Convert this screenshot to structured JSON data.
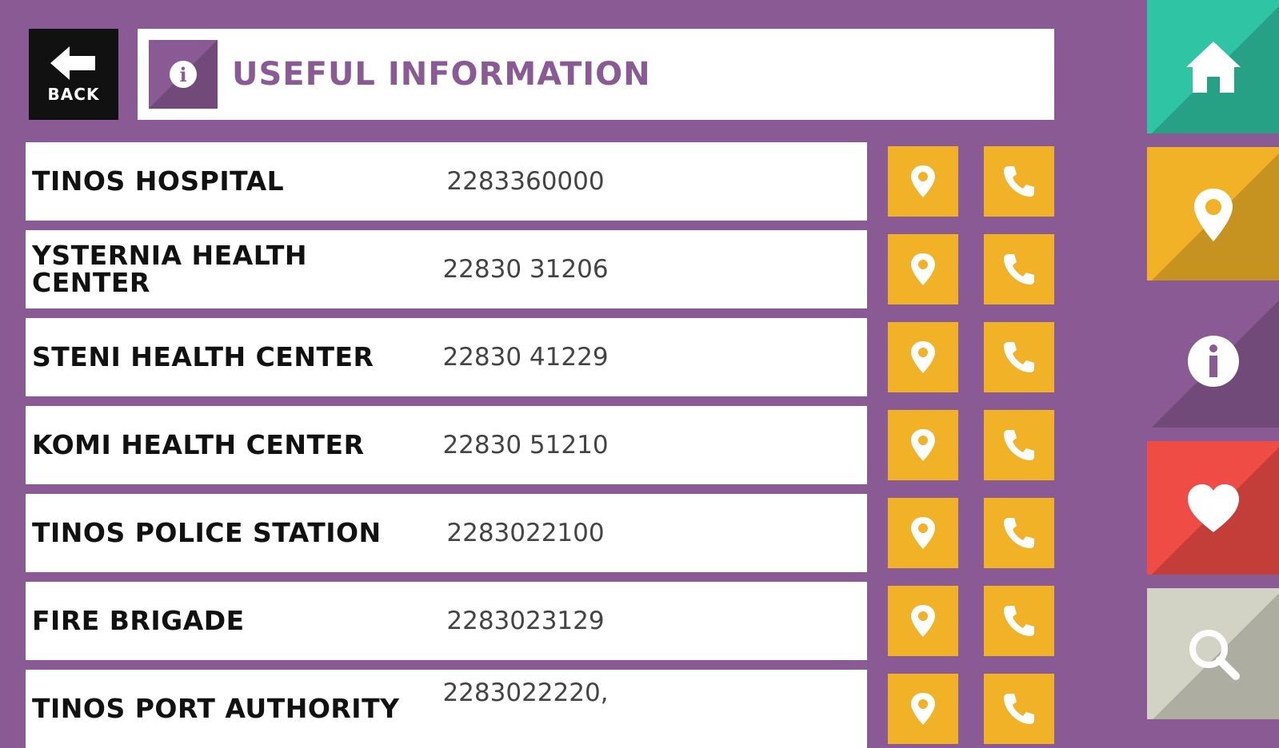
{
  "header": {
    "back_label": "BACK",
    "title": "USEFUL INFORMATION",
    "icon": "info-icon"
  },
  "colors": {
    "background": "#8a5a95",
    "action_button": "#f2b227",
    "home": "#2ec4a4",
    "map": "#f2b227",
    "info": "#8a5a95",
    "favorites": "#ee4c45",
    "search": "#d3d3c5"
  },
  "entries": [
    {
      "name": "TINOS HOSPITAL",
      "phone": "2283360000"
    },
    {
      "name": "YSTERNIA HEALTH CENTER",
      "phone": "22830 31206"
    },
    {
      "name": "STENI HEALTH CENTER",
      "phone": "22830 41229"
    },
    {
      "name": "KOMI HEALTH CENTER",
      "phone": "22830 51210"
    },
    {
      "name": "TINOS POLICE STATION",
      "phone": "2283022100"
    },
    {
      "name": "FIRE BRIGADE",
      "phone": "2283023129"
    },
    {
      "name": "TINOS PORT AUTHORITY",
      "phone": "2283022220,"
    }
  ],
  "row_actions": {
    "map_icon": "map-pin-icon",
    "call_icon": "phone-icon"
  },
  "sidebar": [
    {
      "name": "home",
      "icon": "home-icon"
    },
    {
      "name": "map",
      "icon": "map-pin-icon"
    },
    {
      "name": "info",
      "icon": "info-icon"
    },
    {
      "name": "favorites",
      "icon": "heart-icon"
    },
    {
      "name": "search",
      "icon": "search-icon"
    }
  ]
}
